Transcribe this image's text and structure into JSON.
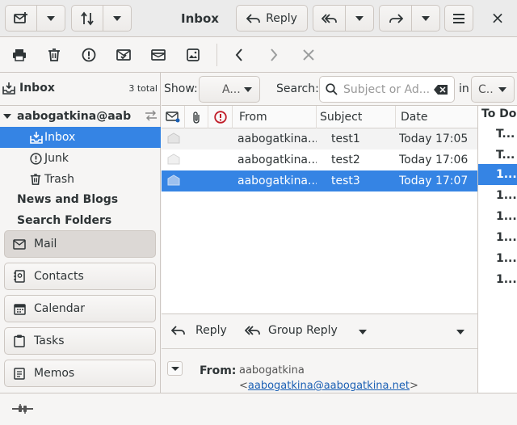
{
  "header": {
    "title": "Inbox",
    "reply_label": "Reply",
    "close_glyph": "×"
  },
  "sidebar": {
    "folder_title": "Inbox",
    "total": "3 total",
    "account": "aabogatkina@aab...",
    "folders": [
      {
        "label": "Inbox",
        "icon": "inbox-icon",
        "selected": true
      },
      {
        "label": "Junk",
        "icon": "junk-icon",
        "selected": false
      },
      {
        "label": "Trash",
        "icon": "trash-icon",
        "selected": false
      }
    ],
    "sections": [
      "News and Blogs",
      "Search Folders"
    ],
    "nav": [
      {
        "label": "Mail",
        "icon": "mail-icon",
        "active": true
      },
      {
        "label": "Contacts",
        "icon": "contacts-icon",
        "active": false
      },
      {
        "label": "Calendar",
        "icon": "calendar-icon",
        "active": false
      },
      {
        "label": "Tasks",
        "icon": "tasks-icon",
        "active": false
      },
      {
        "label": "Memos",
        "icon": "memos-icon",
        "active": false
      }
    ]
  },
  "filter": {
    "show_label": "Show:",
    "show_value": "A...",
    "search_label": "Search:",
    "search_placeholder": "Subject or Ad...",
    "in_label": "in",
    "in_value": "C..."
  },
  "message_list": {
    "columns": [
      "From",
      "Subject",
      "Date"
    ],
    "rows": [
      {
        "from": "aabogatkina...",
        "subject": "test1",
        "date": "Today 17:05",
        "selected": false
      },
      {
        "from": "aabogatkina...",
        "subject": "test2",
        "date": "Today 17:06",
        "selected": false
      },
      {
        "from": "aabogatkina...",
        "subject": "test3",
        "date": "Today 17:07",
        "selected": true
      }
    ]
  },
  "todo": {
    "title": "To Do",
    "items": [
      "T...",
      "T...",
      "1...",
      "1...",
      "1...",
      "1...",
      "1...",
      "1..."
    ]
  },
  "preview": {
    "reply_label": "Reply",
    "group_reply_label": "Group Reply",
    "from_label": "From:",
    "from_name": "aabogatkina",
    "from_email": "aabogatkina@aabogatkina.net",
    "bracket_open": "<",
    "bracket_close": ">"
  },
  "colors": {
    "accent": "#3584e4",
    "important": "#c01c28"
  }
}
